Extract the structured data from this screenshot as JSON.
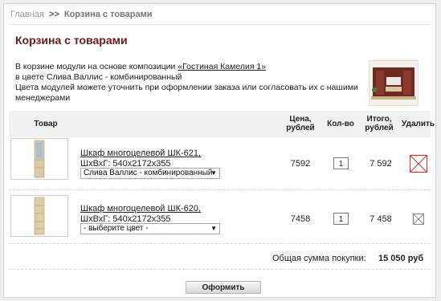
{
  "breadcrumb": {
    "home": "Главная",
    "separator": ">>",
    "current": "Корзина с товарами"
  },
  "page_title": "Корзина с товарами",
  "intro": {
    "line1_prefix": "В корзине модули на основе композиции ",
    "composition_link": "«Гостиная Камелия 1»",
    "line2": "в цвете Слива Валлис - комбинированный",
    "line3": "Цвета модулей можете уточнить при оформлении заказа или согласовать их с нашими менеджерами"
  },
  "table": {
    "headers": {
      "product": "Товар",
      "price": "Цена, рублей",
      "qty": "Кол-во",
      "total": "Итого, рублей",
      "delete": "Удалить"
    },
    "rows": [
      {
        "name": "Шкаф многоцелевой ШК-621,",
        "dims": "ШхВхГ: 540x2172x355",
        "color": "Слива Валлис - комбинированный",
        "price": "7592",
        "qty": "1",
        "total": "7 592",
        "delete_icon": "close-icon",
        "delete_color": "#cc3333"
      },
      {
        "name": "Шкаф многоцелевой ШК-620,",
        "dims": "ШхВхГ: 540x2172x355",
        "color": "- выберите цвет -",
        "price": "7458",
        "qty": "1",
        "total": "7 458",
        "delete_icon": "close-icon",
        "delete_color": "#888888"
      }
    ]
  },
  "summary": {
    "label": "Общая сумма покупки:",
    "value": "15 050 руб"
  },
  "submit_label": "Оформить",
  "colors": {
    "title": "#6b1b1b",
    "header_bg": "#f1f1f1"
  }
}
